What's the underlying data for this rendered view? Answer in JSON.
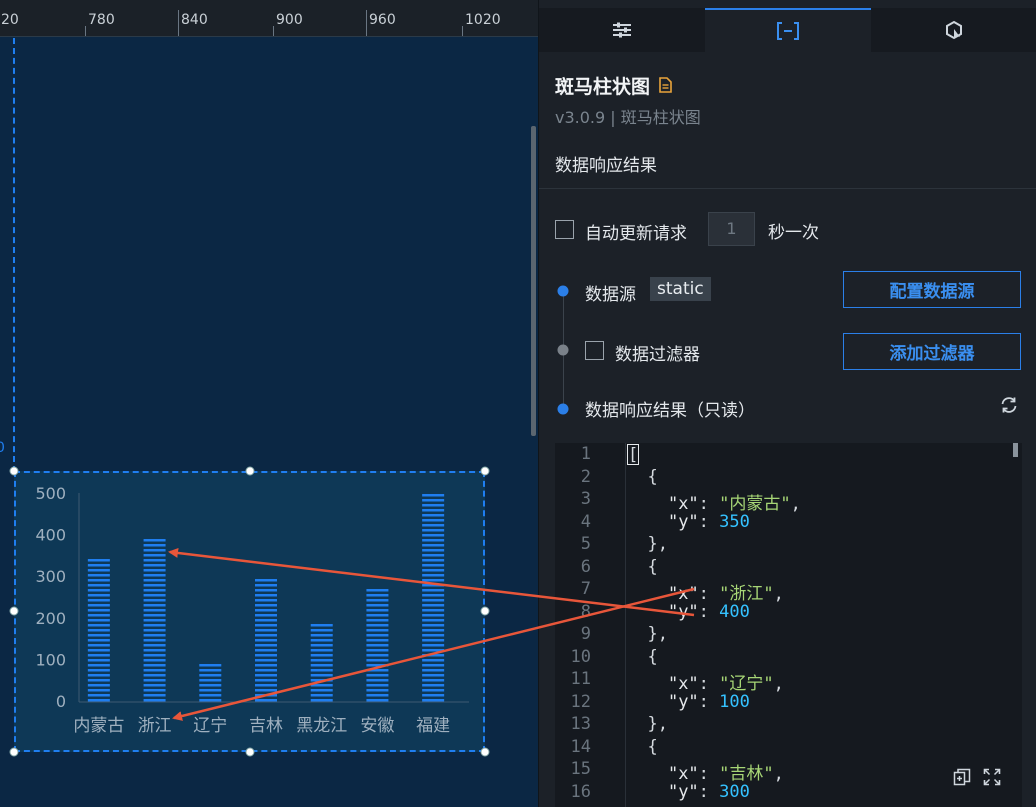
{
  "ruler": {
    "labels": [
      "20",
      "780",
      "840",
      "900",
      "960",
      "1020"
    ]
  },
  "canvas": {
    "edge_label": "0"
  },
  "chart_data": {
    "type": "bar",
    "categories": [
      "内蒙古",
      "浙江",
      "辽宁",
      "吉林",
      "黑龙江",
      "安徽",
      "福建"
    ],
    "values": [
      350,
      400,
      100,
      300,
      195,
      275,
      500
    ],
    "ylim": [
      0,
      500
    ],
    "y_ticks": [
      "0",
      "100",
      "200",
      "300",
      "400",
      "500"
    ],
    "style": "zebra-striped",
    "bar_color": "#1f7ef0"
  },
  "panel": {
    "tabs": [
      {
        "icon": "sliders-icon",
        "active": false
      },
      {
        "icon": "data-bracket-icon",
        "active": true
      },
      {
        "icon": "interaction-icon",
        "active": false
      }
    ],
    "component_title": "斑马柱状图",
    "doc_icon": "document-icon",
    "component_version": "v3.0.9 | 斑马柱状图",
    "section_title": "数据响应结果",
    "auto_update": {
      "label": "自动更新请求",
      "value": "1",
      "suffix": "秒一次",
      "checked": false
    },
    "datasource": {
      "label": "数据源",
      "tag": "static",
      "button": "配置数据源"
    },
    "filter": {
      "label": "数据过滤器",
      "button": "添加过滤器",
      "checked": false
    },
    "response": {
      "label": "数据响应结果（只读）"
    },
    "code": {
      "line_numbers": [
        "1",
        "2",
        "3",
        "4",
        "5",
        "6",
        "7",
        "8",
        "9",
        "10",
        "11",
        "12",
        "13",
        "14",
        "15",
        "16"
      ],
      "lines": [
        "[",
        "  {",
        "    \"x\": \"内蒙古\",",
        "    \"y\": 350",
        "  },",
        "  {",
        "    \"x\": \"浙江\",",
        "    \"y\": 400",
        "  },",
        "  {",
        "    \"x\": \"辽宁\",",
        "    \"y\": 100",
        "  },",
        "  {",
        "    \"x\": \"吉林\",",
        "    \"y\": 300"
      ]
    },
    "colors": {
      "accent": "#2b7fe8",
      "arrow": "#e8563a",
      "string": "#a7d676",
      "number": "#35c2ff"
    }
  }
}
